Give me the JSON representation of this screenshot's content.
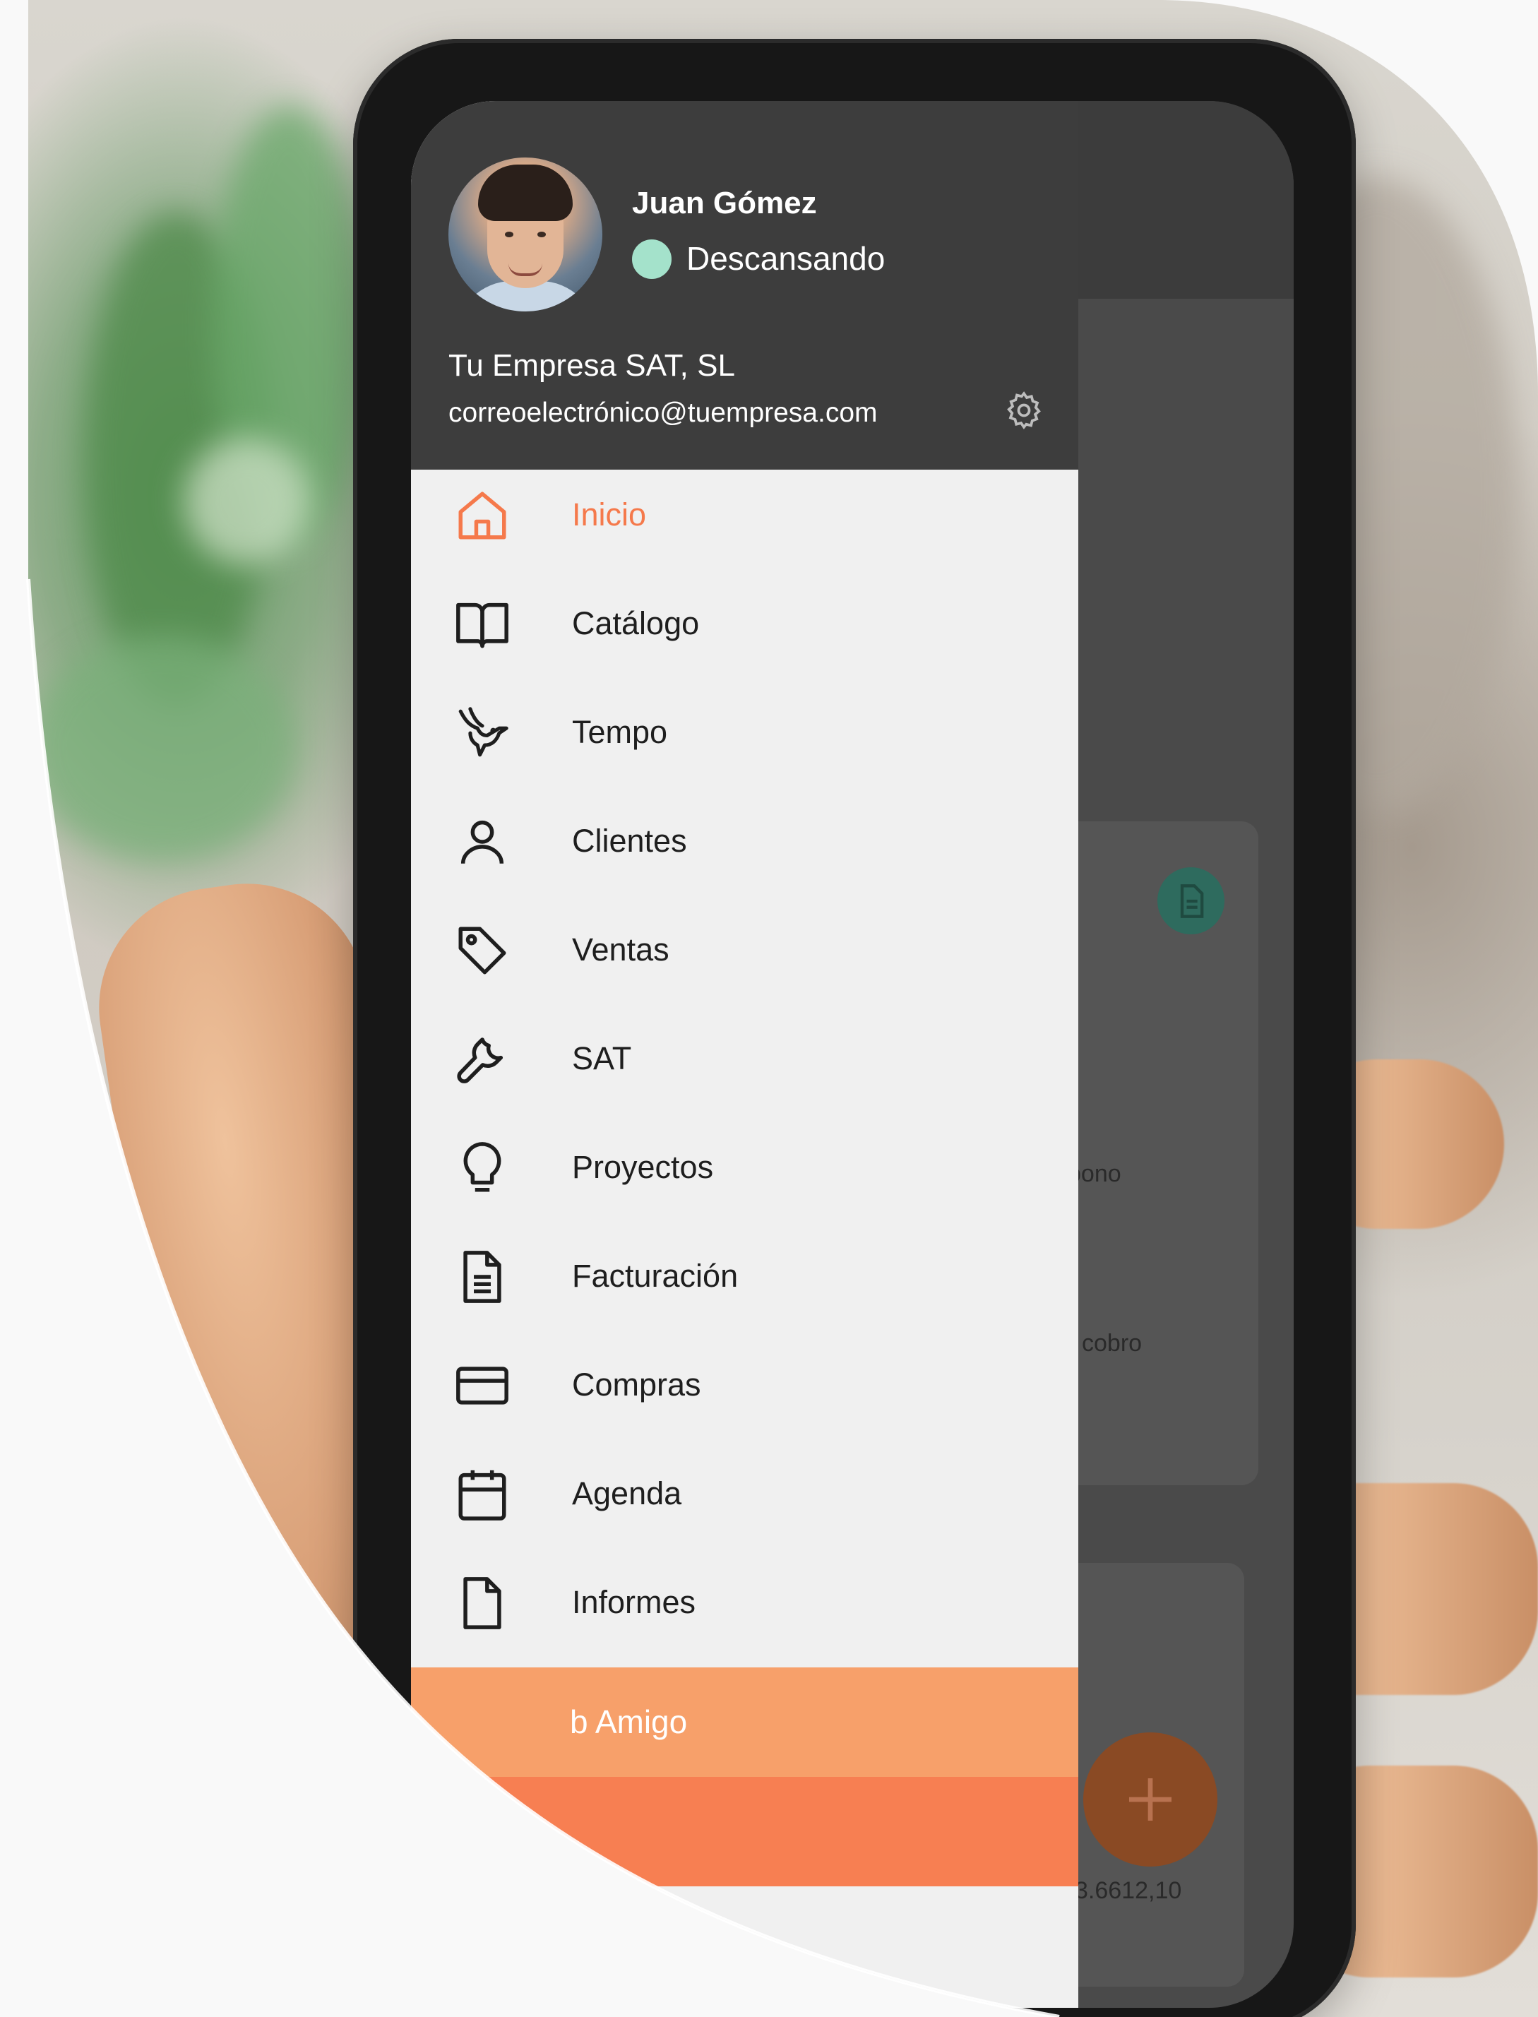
{
  "colors": {
    "accent": "#f5794b",
    "drawer_header": "#3d3d3d",
    "drawer_background": "#f0f0f0",
    "status_resting": "#a4e2cb",
    "promo_light": "#f7a06a",
    "promo_dark": "#f77f52"
  },
  "user": {
    "name": "Juan Gómez",
    "status": "Descansando"
  },
  "company": {
    "name": "Tu Empresa SAT, SL",
    "email": "correoelectrónico@tuempresa.com"
  },
  "header_icons": {
    "settings": "gear-icon"
  },
  "menu": {
    "items": [
      {
        "label": "Inicio",
        "icon": "home-icon",
        "active": true
      },
      {
        "label": "Catálogo",
        "icon": "book-icon",
        "active": false
      },
      {
        "label": "Tempo",
        "icon": "hummingbird-icon",
        "active": false
      },
      {
        "label": "Clientes",
        "icon": "user-icon",
        "active": false
      },
      {
        "label": "Ventas",
        "icon": "tag-icon",
        "active": false
      },
      {
        "label": "SAT",
        "icon": "wrench-icon",
        "active": false
      },
      {
        "label": "Proyectos",
        "icon": "lightbulb-icon",
        "active": false
      },
      {
        "label": "Facturación",
        "icon": "invoice-icon",
        "active": false
      },
      {
        "label": "Compras",
        "icon": "credit-card-icon",
        "active": false
      },
      {
        "label": "Agenda",
        "icon": "calendar-icon",
        "active": false
      },
      {
        "label": "Informes",
        "icon": "report-icon",
        "active": false
      }
    ]
  },
  "promo": {
    "label": "b Amigo"
  },
  "background_app": {
    "partial_text_1": "pono",
    "partial_text_2": "cobro",
    "partial_amount": "3.6612,10",
    "fab_icon": "plus-icon",
    "doc_icon": "document-icon"
  }
}
